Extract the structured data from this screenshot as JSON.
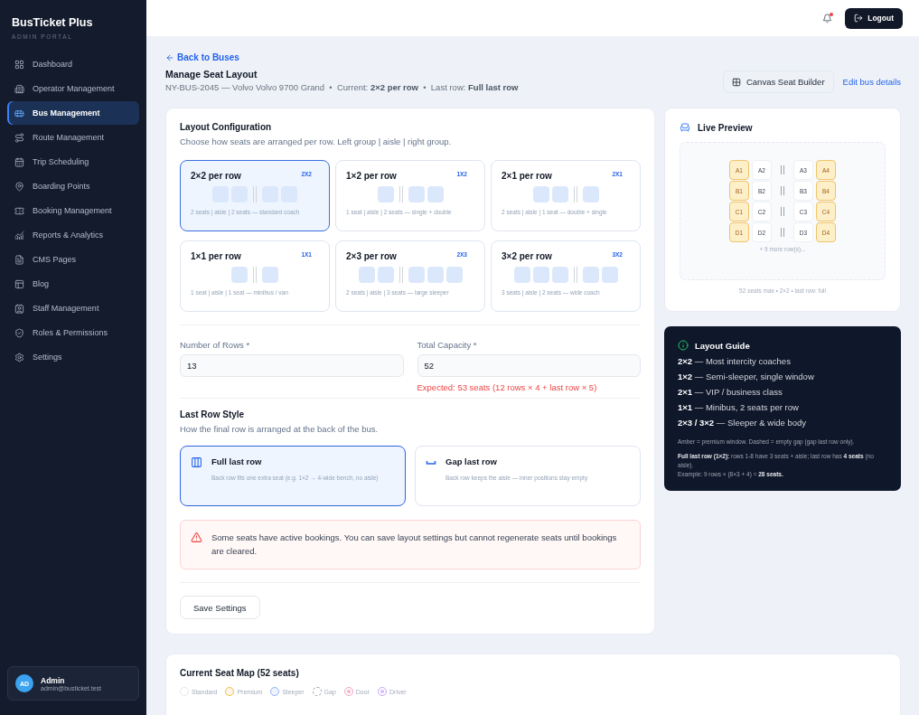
{
  "sidebar": {
    "brand": "BusTicket Plus",
    "subtitle": "ADMIN PORTAL",
    "items": [
      {
        "label": "Dashboard",
        "selected": false
      },
      {
        "label": "Operator Management",
        "selected": false
      },
      {
        "label": "Bus Management",
        "selected": true
      },
      {
        "label": "Route Management",
        "selected": false
      },
      {
        "label": "Trip Scheduling",
        "selected": false
      },
      {
        "label": "Boarding Points",
        "selected": false
      },
      {
        "label": "Booking Management",
        "selected": false
      },
      {
        "label": "Reports & Analytics",
        "selected": false
      },
      {
        "label": "CMS Pages",
        "selected": false
      },
      {
        "label": "Blog",
        "selected": false
      },
      {
        "label": "Staff Management",
        "selected": false
      },
      {
        "label": "Roles & Permissions",
        "selected": false
      },
      {
        "label": "Settings",
        "selected": false
      }
    ],
    "user": {
      "initials": "AD",
      "name": "Admin",
      "email": "admin@busticket.test"
    }
  },
  "topbar": {
    "notification_dot": true,
    "logout": "Logout"
  },
  "header": {
    "back": "Back to Buses",
    "title": "Manage Seat Layout",
    "subtitle": "NY-BUS-2045 — Volvo Volvo 9700 Grand  •  Current: **2×2 per row**  •  Last row: **Full last row**",
    "canvas_button": "Canvas Seat Builder",
    "edit_link": "Edit bus details"
  },
  "layout_config": {
    "title": "Layout Configuration",
    "description": "Choose how seats are arranged per row. Left group | aisle | right group.",
    "options": [
      {
        "label": "2×2 per row",
        "badge": "2X2",
        "note": "2 seats | aisle | 2 seats — standard coach",
        "kind": "two_two",
        "selected": true
      },
      {
        "label": "1×2 per row",
        "badge": "1X2",
        "note": "1 seat | aisle | 2 seats — single + double",
        "kind": "one_two",
        "selected": false
      },
      {
        "label": "2×1 per row",
        "badge": "2X1",
        "note": "2 seats | aisle | 1 seat — double + single",
        "kind": "two_one",
        "selected": false
      },
      {
        "label": "1×1 per row",
        "badge": "1X1",
        "note": "1 seat | aisle | 1 seat — minibus / van",
        "kind": "one_one",
        "selected": false
      },
      {
        "label": "2×3 per row",
        "badge": "2X3",
        "note": "2 seats | aisle | 3 seats — large sleeper",
        "kind": "two_three",
        "selected": false
      },
      {
        "label": "3×2 per row",
        "badge": "3X2",
        "note": "3 seats | aisle | 2 seats — wide coach",
        "kind": "three_two",
        "selected": false
      }
    ],
    "rows_label": "Number of Rows *",
    "rows_value": "13",
    "capacity_label": "Total Capacity *",
    "capacity_value": "52",
    "capacity_error": "Expected: 53 seats (12 rows × 4 + last row × 5)"
  },
  "last_row": {
    "title": "Last Row Style",
    "description": "How the final row is arranged at the back of the bus.",
    "options": [
      {
        "kind": "full",
        "label": "Full last row",
        "note": "Back row fits one extra seat (e.g. 1×2 → 4-wide bench, no aisle)",
        "selected": true
      },
      {
        "kind": "gap",
        "label": "Gap last row",
        "note": "Back row keeps the aisle — inner positions stay empty",
        "selected": false
      }
    ]
  },
  "warning": "Some seats have active bookings. You can save layout settings but cannot regenerate seats until bookings are cleared.",
  "save_button": "Save Settings",
  "preview": {
    "title": "Live Preview",
    "rows": [
      {
        "left": [
          {
            "label": "A1",
            "premium": true
          },
          {
            "label": "A2",
            "premium": false
          }
        ],
        "right": [
          {
            "label": "A3",
            "premium": false
          },
          {
            "label": "A4",
            "premium": true
          }
        ]
      },
      {
        "left": [
          {
            "label": "B1",
            "premium": true
          },
          {
            "label": "B2",
            "premium": false
          }
        ],
        "right": [
          {
            "label": "B3",
            "premium": false
          },
          {
            "label": "B4",
            "premium": true
          }
        ]
      },
      {
        "left": [
          {
            "label": "C1",
            "premium": true
          },
          {
            "label": "C2",
            "premium": false
          }
        ],
        "right": [
          {
            "label": "C3",
            "premium": false
          },
          {
            "label": "C4",
            "premium": true
          }
        ]
      },
      {
        "left": [
          {
            "label": "D1",
            "premium": true
          },
          {
            "label": "D2",
            "premium": false
          }
        ],
        "right": [
          {
            "label": "D3",
            "premium": false
          },
          {
            "label": "D4",
            "premium": true
          }
        ]
      }
    ],
    "more": "+ 9 more row(s)...",
    "footer": "52 seats max • 2×2 • last row: full"
  },
  "guide": {
    "title": "Layout Guide",
    "items": [
      "**2×2** — Most intercity coaches",
      "**1×2** — Semi-sleeper, single window",
      "**2×1** — VIP / business class",
      "**1×1** — Minibus, 2 seats per row",
      "**2×3 / 3×2** — Sleeper & wide body"
    ],
    "notes": [
      "Amber = premium window. Dashed = empty gap (gap last row only).",
      "**Full last row (1×2):** rows 1-8 have 3 seats + aisle; last row has **4 seats** (no aisle).",
      "Example: 9 rows × (8×3 + 4) = **28 seats.**"
    ]
  },
  "seat_map": {
    "title": "Current Seat Map (52 seats)",
    "legend": [
      {
        "kind": "standard",
        "label": "Standard"
      },
      {
        "kind": "premium",
        "label": "Premium"
      },
      {
        "kind": "sleeper",
        "label": "Sleeper"
      },
      {
        "kind": "gap",
        "label": "Gap"
      },
      {
        "kind": "door",
        "label": "Door"
      },
      {
        "kind": "driver",
        "label": "Driver"
      }
    ]
  }
}
